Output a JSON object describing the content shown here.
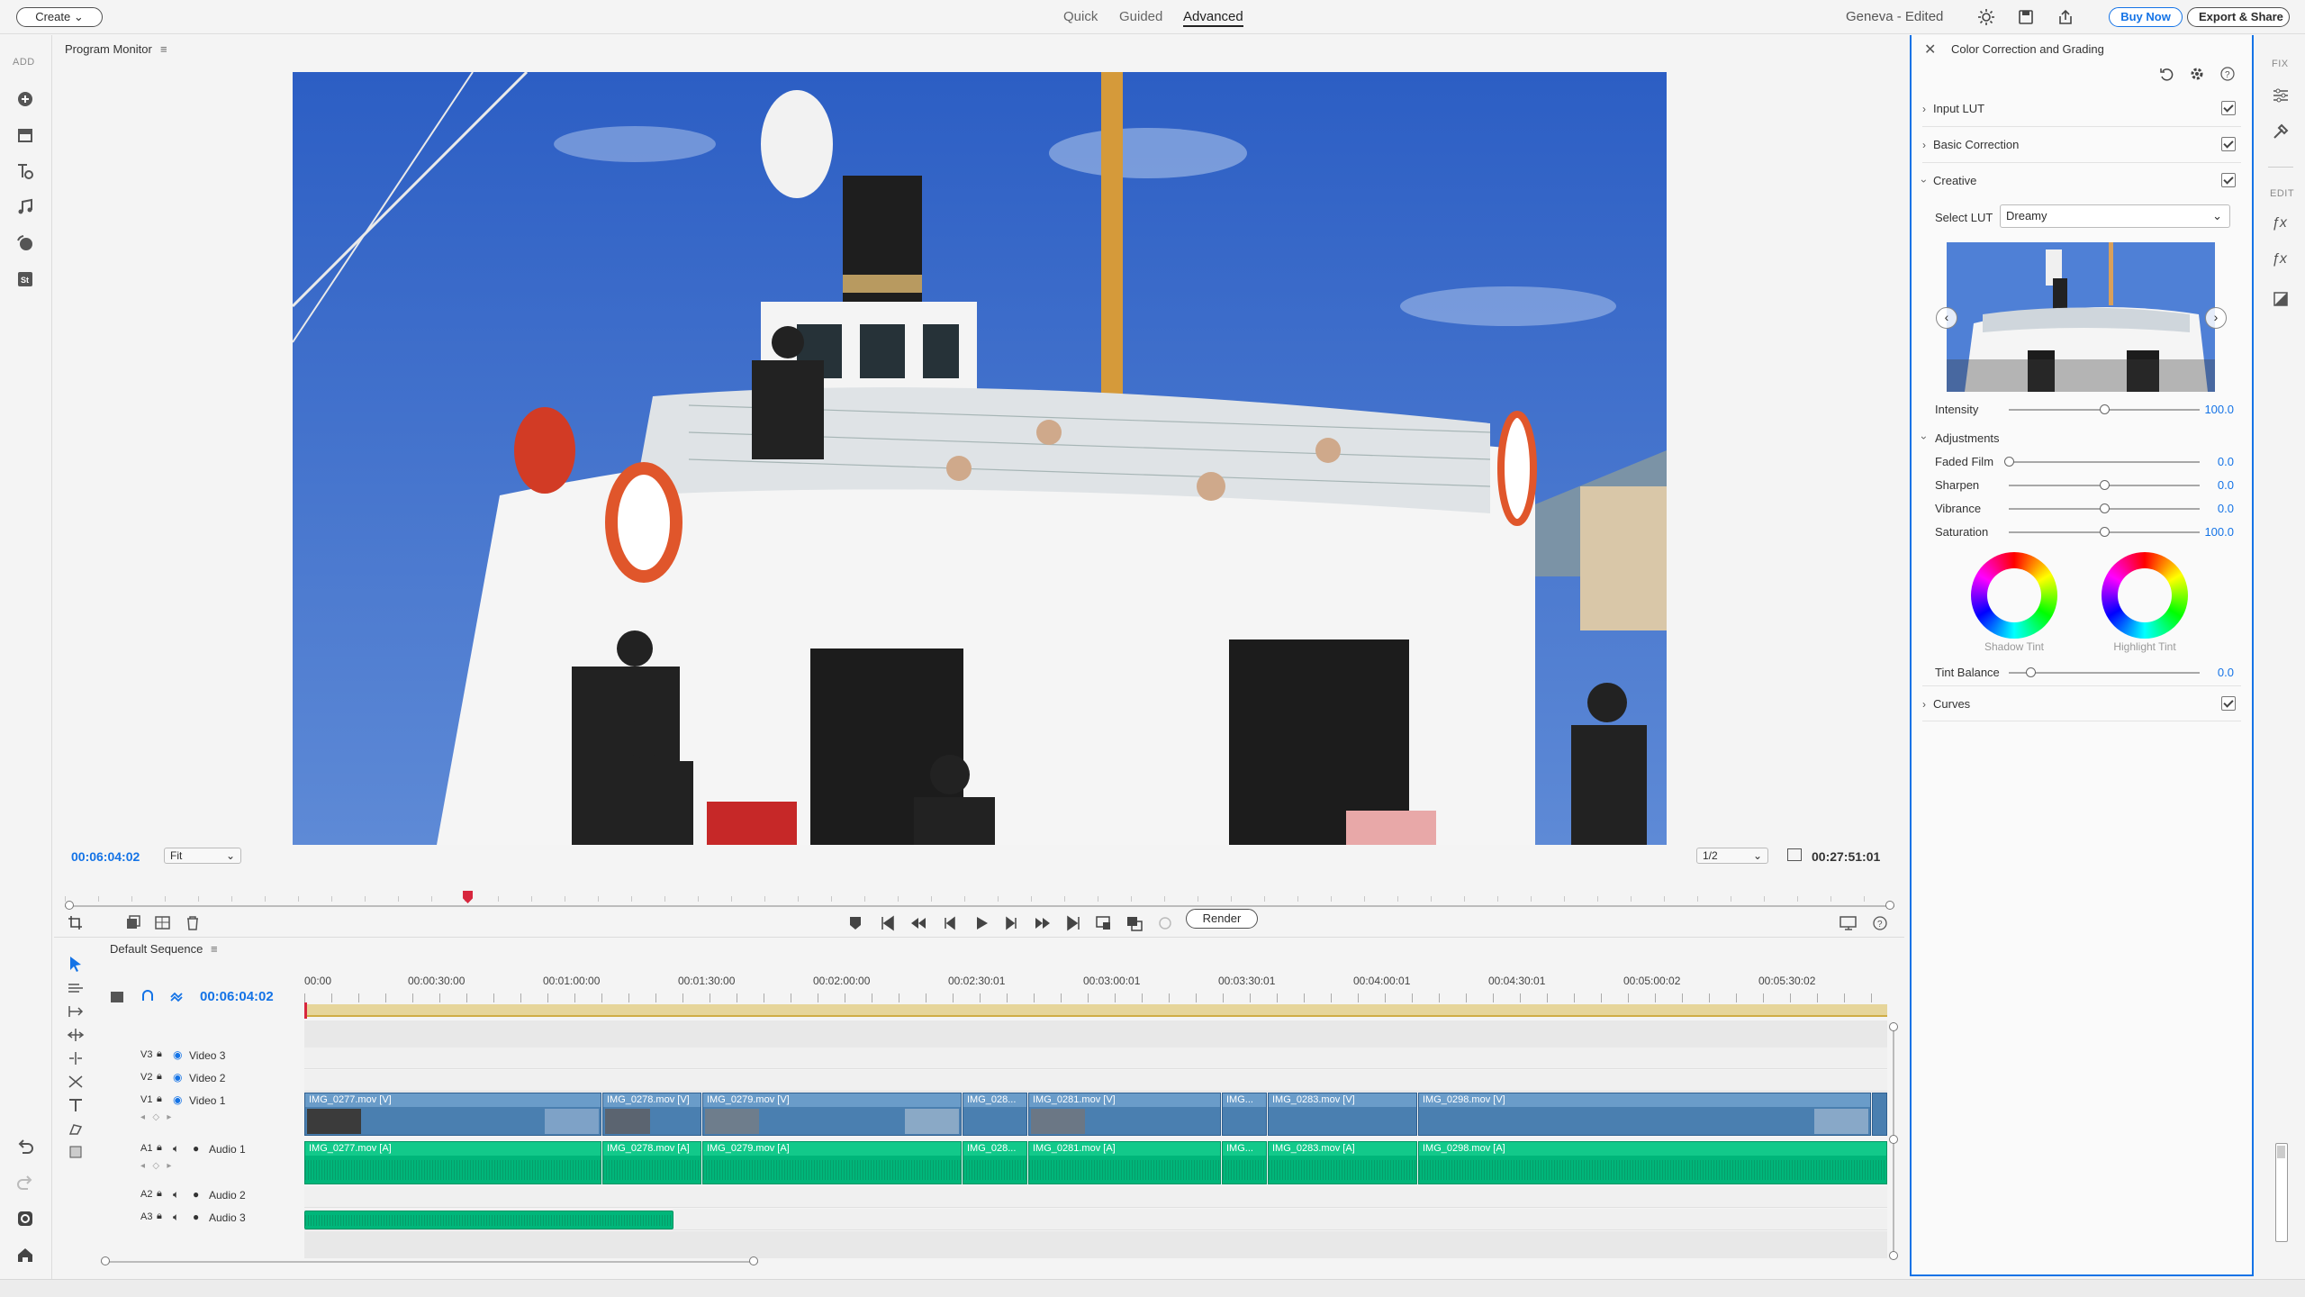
{
  "topbar": {
    "create_label": "Create",
    "modes": [
      "Quick",
      "Guided",
      "Advanced"
    ],
    "active_mode": "Advanced",
    "project_title": "Geneva - Edited",
    "buy_label": "Buy Now",
    "export_label": "Export & Share"
  },
  "left_sidebar": {
    "section_label": "ADD",
    "icons": [
      "add-media-icon",
      "media-bin-icon",
      "titles-icon",
      "music-icon",
      "transitions-icon",
      "stock-icon"
    ],
    "bottom_icons": [
      "undo-icon",
      "redo-icon",
      "organizer-icon",
      "home-icon"
    ]
  },
  "monitor": {
    "title": "Program Monitor",
    "current_time": "00:06:04:02",
    "fit_value": "Fit",
    "resolution_value": "1/2",
    "duration": "00:27:51:01",
    "render_label": "Render",
    "playhead_fraction": 0.22
  },
  "timeline": {
    "sequence_name": "Default Sequence",
    "timecode": "00:06:04:02",
    "ruler_ticks": [
      "00:00",
      "00:00:30:00",
      "00:01:00:00",
      "00:01:30:00",
      "00:02:00:00",
      "00:02:30:01",
      "00:03:00:01",
      "00:03:30:01",
      "00:04:00:01",
      "00:04:30:01",
      "00:05:00:02",
      "00:05:30:02"
    ],
    "tracks": [
      {
        "id": "V3",
        "name": "Video 3"
      },
      {
        "id": "V2",
        "name": "Video 2"
      },
      {
        "id": "V1",
        "name": "Video 1"
      },
      {
        "id": "A1",
        "name": "Audio 1"
      },
      {
        "id": "A2",
        "name": "Audio 2"
      },
      {
        "id": "A3",
        "name": "Audio 3"
      }
    ],
    "video_clips": [
      "IMG_0277.mov [V]",
      "IMG_0278.mov [V]",
      "IMG_0279.mov [V]",
      "IMG_028...",
      "IMG_0281.mov [V]",
      "IMG...",
      "IMG_0283.mov [V]",
      "IMG_0298.mov [V]"
    ],
    "audio_clips": [
      "IMG_0277.mov [A]",
      "IMG_0278.mov [A]",
      "IMG_0279.mov [A]",
      "IMG_028...",
      "IMG_0281.mov [A]",
      "IMG...",
      "IMG_0283.mov [A]",
      "IMG_0298.mov [A]"
    ]
  },
  "color_panel": {
    "title": "Color Correction and Grading",
    "sections": {
      "input_lut": "Input LUT",
      "basic_correction": "Basic Correction",
      "creative": "Creative",
      "curves": "Curves"
    },
    "select_lut_label": "Select LUT",
    "select_lut_value": "Dreamy",
    "intensity_label": "Intensity",
    "intensity_value": "100.0",
    "adjustments_label": "Adjustments",
    "sliders": [
      {
        "label": "Faded Film",
        "value": "0.0",
        "level": 0.0
      },
      {
        "label": "Sharpen",
        "value": "0.0",
        "level": 0.5
      },
      {
        "label": "Vibrance",
        "value": "0.0",
        "level": 0.5
      },
      {
        "label": "Saturation",
        "value": "100.0",
        "level": 0.5
      }
    ],
    "shadow_tint_label": "Shadow Tint",
    "highlight_tint_label": "Highlight Tint",
    "tint_balance_label": "Tint Balance",
    "tint_balance_value": "0.0"
  },
  "right_tabs": {
    "fix_label": "FIX",
    "edit_label": "EDIT"
  },
  "colors": {
    "accent": "#1473e6",
    "video_clip": "#4a7fb0",
    "audio_clip": "#00b67a"
  }
}
